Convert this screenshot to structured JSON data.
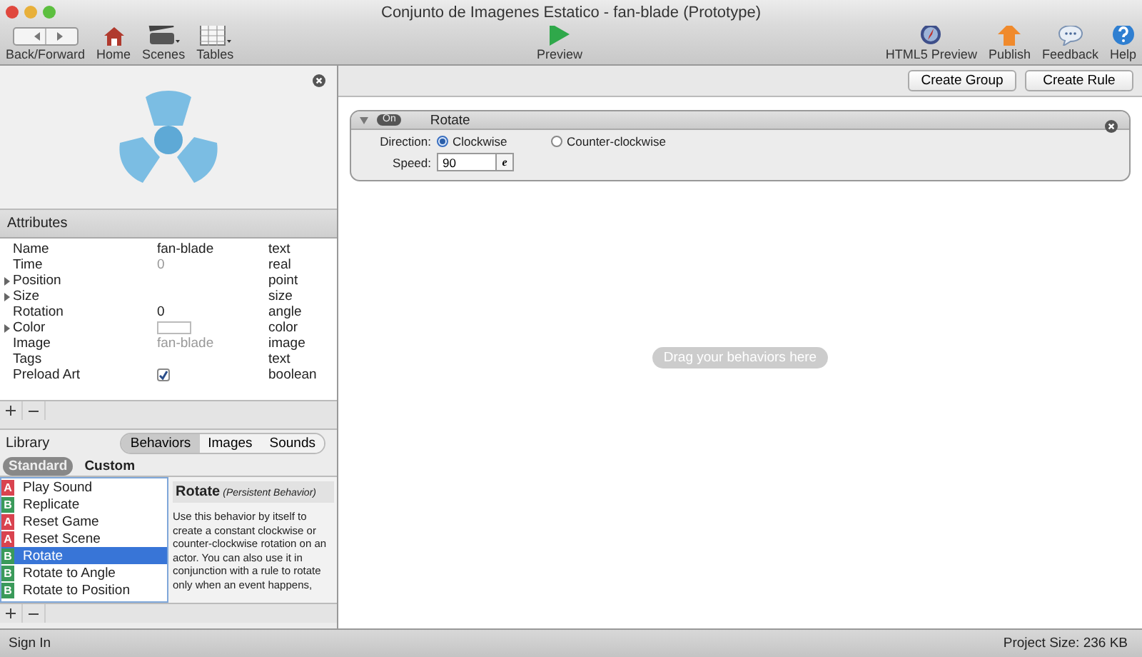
{
  "window": {
    "title": "Conjunto de Imagenes Estatico - fan-blade (Prototype)"
  },
  "toolbar": {
    "left": [
      {
        "kind": "backforward",
        "label": "Back/Forward"
      },
      {
        "kind": "home",
        "label": "Home"
      },
      {
        "kind": "scenes",
        "label": "Scenes"
      },
      {
        "kind": "tables",
        "label": "Tables"
      }
    ],
    "center": [
      {
        "kind": "preview",
        "label": "Preview"
      }
    ],
    "right": [
      {
        "kind": "html5",
        "label": "HTML5 Preview"
      },
      {
        "kind": "publish",
        "label": "Publish"
      },
      {
        "kind": "feedback",
        "label": "Feedback"
      },
      {
        "kind": "help",
        "label": "Help"
      }
    ]
  },
  "attributes": {
    "title": "Attributes",
    "rows": [
      {
        "name": "Name",
        "value": "fan-blade",
        "type": "text",
        "kind": "text",
        "expandable": false,
        "dim": false
      },
      {
        "name": "Time",
        "value": "0",
        "type": "real",
        "kind": "text",
        "expandable": false,
        "dim": true
      },
      {
        "name": "Position",
        "type": "point",
        "kind": "empty",
        "expandable": true
      },
      {
        "name": "Size",
        "type": "size",
        "kind": "empty",
        "expandable": true
      },
      {
        "name": "Rotation",
        "value": "0",
        "type": "angle",
        "kind": "text",
        "expandable": false,
        "dim": false
      },
      {
        "name": "Color",
        "type": "color",
        "kind": "swatch",
        "expandable": true,
        "color": "#ffffff"
      },
      {
        "name": "Image",
        "value": "fan-blade",
        "type": "image",
        "kind": "text",
        "expandable": false,
        "dim": true
      },
      {
        "name": "Tags",
        "type": "text",
        "kind": "empty",
        "expandable": false
      },
      {
        "name": "Preload Art",
        "type": "boolean",
        "kind": "checkbox",
        "expandable": false,
        "checked": true
      }
    ]
  },
  "library": {
    "title": "Library",
    "tabs": [
      {
        "label": "Behaviors",
        "selected": true
      },
      {
        "label": "Images",
        "selected": false
      },
      {
        "label": "Sounds",
        "selected": false
      }
    ],
    "filters": [
      {
        "label": "Standard",
        "selected": true
      },
      {
        "label": "Custom",
        "selected": false
      }
    ],
    "items": [
      {
        "badge": "A",
        "color": "#d9434f",
        "label": "Play Sound",
        "selected": false
      },
      {
        "badge": "B",
        "color": "#3a9a5a",
        "label": "Replicate",
        "selected": false
      },
      {
        "badge": "A",
        "color": "#d9434f",
        "label": "Reset Game",
        "selected": false
      },
      {
        "badge": "A",
        "color": "#d9434f",
        "label": "Reset Scene",
        "selected": false
      },
      {
        "badge": "B",
        "color": "#3a9a5a",
        "label": "Rotate",
        "selected": true
      },
      {
        "badge": "B",
        "color": "#3a9a5a",
        "label": "Rotate to Angle",
        "selected": false
      },
      {
        "badge": "B",
        "color": "#3a9a5a",
        "label": "Rotate to Position",
        "selected": false
      }
    ],
    "description": {
      "title": "Rotate",
      "subtitle": "(Persistent Behavior)",
      "text": "Use this behavior by itself to create a constant clockwise or counter-clockwise rotation on an actor. You can also use it in conjunction with a rule to rotate only when an event happens,"
    }
  },
  "actions": [
    "Create Group",
    "Create Rule"
  ],
  "behavior": {
    "toggle": "On",
    "on": true,
    "expanded": true,
    "title": "Rotate",
    "direction_label": "Direction:",
    "options": [
      {
        "label": "Clockwise",
        "selected": true
      },
      {
        "label": "Counter-clockwise",
        "selected": false
      }
    ],
    "speed_label": "Speed:",
    "speed": "90",
    "expression_symbol": "e"
  },
  "drop_hint": "Drag your behaviors here",
  "status_bar": {
    "sign_in": "Sign In",
    "project_size": "Project Size: 236 KB"
  }
}
